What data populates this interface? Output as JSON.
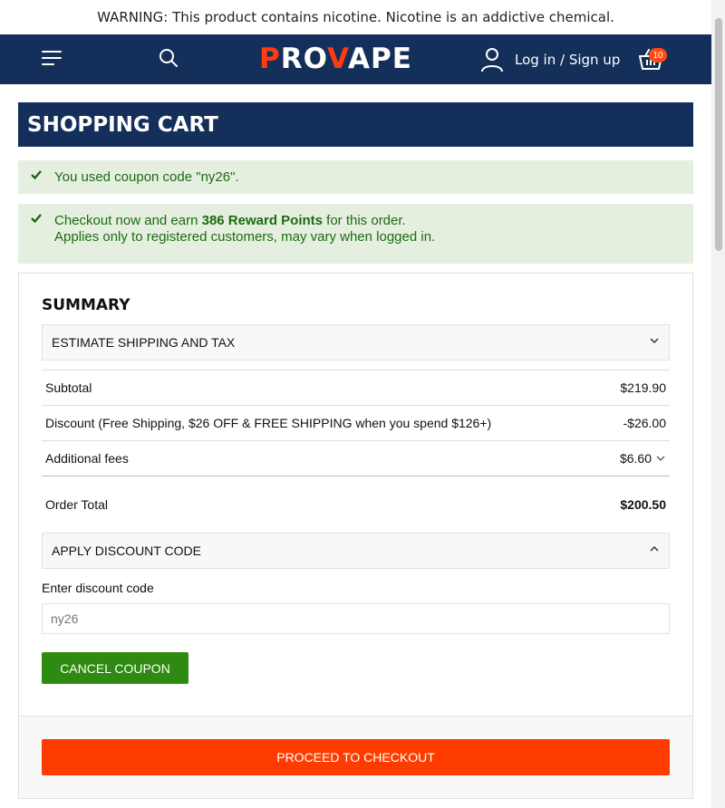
{
  "warning": "WARNING: This product contains nicotine. Nicotine is an addictive chemical.",
  "header": {
    "logo_prefix": "P",
    "logo_mid": "RO",
    "logo_accent_v": "V",
    "logo_suffix": "APE",
    "account_label": "Log in / Sign up",
    "cart_count": "10",
    "icons": [
      "menu-icon",
      "search-icon",
      "user-icon",
      "basket-icon"
    ]
  },
  "page_title": "SHOPPING CART",
  "messages": {
    "coupon": "You used coupon code \"ny26\".",
    "reward_pre": "Checkout now and earn ",
    "reward_bold": "386 Reward Points",
    "reward_post": " for this order.",
    "reward_note": "Applies only to registered customers, may vary when logged in."
  },
  "summary": {
    "title": "SUMMARY",
    "estimate_label": "ESTIMATE SHIPPING AND TAX",
    "rows": [
      {
        "label": "Subtotal",
        "value": "$219.90"
      },
      {
        "label": "Discount (Free Shipping, $26 OFF & FREE SHIPPING when you spend $126+)",
        "value": "-$26.00"
      },
      {
        "label": "Additional fees",
        "value": "$6.60"
      },
      {
        "label": "Order Total",
        "value": "$200.50"
      }
    ],
    "discount_toggle_label": "APPLY DISCOUNT CODE",
    "discount_field_label": "Enter discount code",
    "discount_placeholder": "ny26",
    "cancel_label": "CANCEL COUPON",
    "checkout_label": "PROCEED TO CHECKOUT"
  },
  "colors": {
    "navy": "#14305a",
    "accent": "#ff3c0f",
    "success_bg": "#e5efe0",
    "success_text": "#1c6b10",
    "cancel_green": "#2e8a10",
    "checkout_orange": "#ff3c00"
  }
}
